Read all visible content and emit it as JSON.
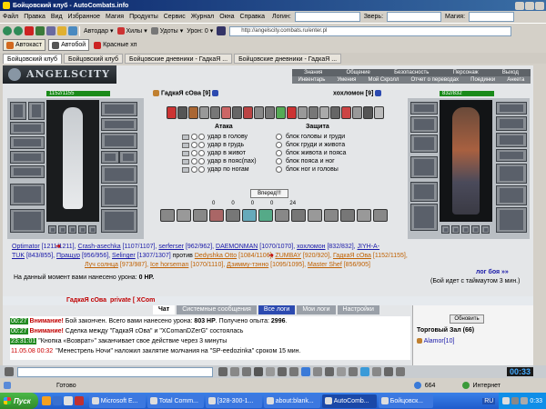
{
  "window": {
    "title": "Бойцовский клуб - AutoCombats.info"
  },
  "menubar": {
    "items": [
      "Файл",
      "Правка",
      "Вид",
      "Избранное",
      "Магия",
      "Продукты",
      "Сервис",
      "Журнал",
      "Окна",
      "Справка"
    ],
    "login_label": "Логин:",
    "beast_label": "Зверь:",
    "magic_label": "Магия:"
  },
  "toolbar": {
    "autodar": "Автодар",
    "heals": "Хилы",
    "udots": "Удоты",
    "uron": "Урон: 0",
    "url": "http://angelscity.combats.ru/enter.pl"
  },
  "toolbar2": {
    "autocast": "Автокаст",
    "autoboy": "Автобой",
    "red_hp": "Красные хп"
  },
  "tabs": [
    "Бойцовский клуб",
    "Бойцовский клуб",
    "Бойцовские дневники - ГадкаЯ ...",
    "Бойцовские дневники - ГадкаЯ ..."
  ],
  "nav": {
    "row1": [
      "Знания",
      "Общение",
      "Безопасность",
      "Персонаж",
      "Выход"
    ],
    "row2": [
      "Инвентарь",
      "Умения",
      "Мой Скролл",
      "Отчет о переводах",
      "Поединки",
      "Анкета"
    ],
    "logo": "ANGELSCITY"
  },
  "battle": {
    "left": {
      "hp": "1152/1155",
      "name": "ГадкаЯ сОва",
      "level": "[9]"
    },
    "right": {
      "hp": "832/832",
      "name": "хохломон",
      "level": "[9]"
    },
    "attack_header": "Атака",
    "defense_header": "Защита",
    "attacks": [
      "удар в голову",
      "удар в грудь",
      "удар в живот",
      "удар в пояс(пах)",
      "удар по ногам"
    ],
    "defenses": [
      "блок головы и груди",
      "блок груди и живота",
      "блок живота и пояса",
      "блок пояса и ног",
      "блок ног и головы"
    ],
    "go_button": "Вперед!!!",
    "counters": [
      "0",
      "0",
      "0",
      "0",
      "24"
    ],
    "versus": "против",
    "damage_label": "На данный момент вами нанесено урона:",
    "damage_value": "0 HP.",
    "log_link": "лог боя »»",
    "timeout": "(Бой идет с таймаутом 3 мин.)"
  },
  "fighters_line1": [
    {
      "t": "Optimator",
      "c": "blue"
    },
    {
      "t": " [1211/1211], ",
      "c": "blue"
    },
    {
      "t": "Crash-asechka",
      "c": "blue"
    },
    {
      "t": " [1107/1107], ",
      "c": "blue"
    },
    {
      "t": "serferser",
      "c": "blue"
    },
    {
      "t": " [962/962], ",
      "c": "blue"
    },
    {
      "t": "DAEMONMAN",
      "c": "blue"
    },
    {
      "t": " [1070/1070], ",
      "c": "blue"
    },
    {
      "t": "хохломон",
      "c": "blue"
    },
    {
      "t": " [832/832], ",
      "c": "blue"
    },
    {
      "t": "JIYH-A-",
      "c": "blue"
    }
  ],
  "fighters_line2": [
    {
      "t": "TUK",
      "c": "blue"
    },
    {
      "t": " [843/855], ",
      "c": "blue"
    },
    {
      "t": "Пращур",
      "c": "blue"
    },
    {
      "t": " [956/956], ",
      "c": "blue"
    },
    {
      "t": "Selinger",
      "c": "blue"
    },
    {
      "t": " [1307/1307] ",
      "c": "blue"
    },
    {
      "t": "против ",
      "c": "black"
    },
    {
      "t": "Dedyshka Otto",
      "c": "orange"
    },
    {
      "t": " [1084/1106], ",
      "c": "orange"
    },
    {
      "t": "ZUMBAY",
      "c": "orange"
    },
    {
      "t": " [920/920], ",
      "c": "orange"
    },
    {
      "t": "ГадкаЯ сОва",
      "c": "orange"
    },
    {
      "t": " [1152/1155],",
      "c": "orange"
    }
  ],
  "fighters_line3": [
    {
      "t": "Луч солнца",
      "c": "orange"
    },
    {
      "t": " [973/987], ",
      "c": "orange"
    },
    {
      "t": "Ice horseman",
      "c": "orange"
    },
    {
      "t": " [1070/1110], ",
      "c": "orange"
    },
    {
      "t": "Дзимму-тэнно",
      "c": "orange"
    },
    {
      "t": " [1095/1095], ",
      "c": "orange"
    },
    {
      "t": "Master Shef",
      "c": "orange"
    },
    {
      "t": " [856/905]",
      "c": "orange"
    }
  ],
  "chat": {
    "top_names": [
      "ГадкаЯ сОва",
      "private [ XCom"
    ],
    "tabs": [
      "Чат",
      "Системные сообщения",
      "Все логи",
      "Мои логи",
      "Настройки"
    ],
    "messages": [
      {
        "time": "00:27",
        "label": "Внимание!",
        "text": " Бой закончен. Всего вами нанесено урона: ",
        "bold": "803 HP",
        "tail": ". Получено опыта: ",
        "bold2": "2996",
        "end": "."
      },
      {
        "time": "00:27",
        "label": "Внимание!",
        "text": " Сделка между \"ГадкаЯ сОва\" и \"XComanDZerG\" состоялась"
      },
      {
        "time": "23:31:01",
        "label": "",
        "text": "\"Кнопка «Возврат»\" заканчивает свое действие через 3 минуты"
      },
      {
        "time": "11.05.08 00:32",
        "label": "",
        "text": "\"Менестрель Ночи\" наложил заклятие молчания на \"SP-eedozinka\" сроком 15 мин."
      }
    ],
    "refresh_button": "Обновить",
    "room": "Торговый Зал (66)",
    "user": "Alamor[10]"
  },
  "clock": "00:33",
  "statusbar": {
    "ready": "Готово",
    "count": "664",
    "zone": "Интернет"
  },
  "taskbar": {
    "start": "Пуск",
    "items": [
      "Microsoft E...",
      "Total Comm...",
      "[328-300-1...",
      "about:blank...",
      "AutoComb...",
      "Бойцовск..."
    ],
    "lang": "RU",
    "time": "0:33"
  },
  "colors": {
    "title_bar": "#0a246a",
    "desktop_blue": "#1f5ccc",
    "battle_bg": "#d8dce0",
    "nav_bg": "#6e7378"
  }
}
